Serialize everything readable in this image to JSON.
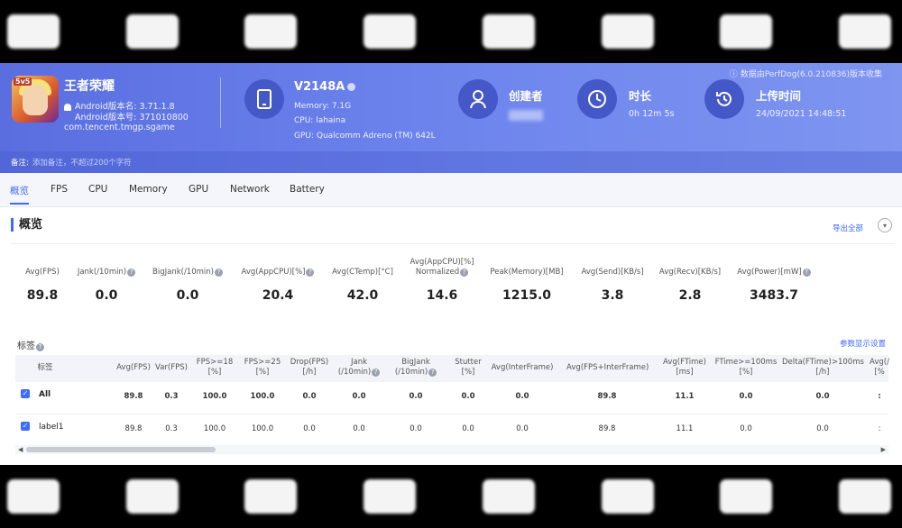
{
  "app": {
    "name": "王者荣耀",
    "icon_tag": "5v5",
    "android_version": "Android版本名: 3.71.1.8",
    "android_code": "Android版本号: 371010800",
    "package": "com.tencent.tmgp.sgame"
  },
  "source_note": "数据由PerfDog(6.0.210836)版本收集",
  "device": {
    "name": "V2148A",
    "memory": "Memory: 7.1G",
    "cpu": "CPU: lahaina",
    "gpu": "GPU: Qualcomm Adreno (TM) 642L"
  },
  "creator": {
    "label": "创建者"
  },
  "duration": {
    "label": "时长",
    "value": "0h 12m 5s"
  },
  "upload": {
    "label": "上传时间",
    "value": "24/09/2021 14:48:51"
  },
  "remark": {
    "label": "备注:",
    "placeholder": "添加备注，不超过200个字符"
  },
  "tabs": [
    "概览",
    "FPS",
    "CPU",
    "Memory",
    "GPU",
    "Network",
    "Battery"
  ],
  "overview": {
    "title": "概览",
    "export": "导出全部",
    "metrics": [
      {
        "label": "Avg(FPS)",
        "value": "89.8",
        "help": false
      },
      {
        "label": "Jank(/10min)",
        "value": "0.0",
        "help": true
      },
      {
        "label": "BigJank(/10min)",
        "value": "0.0",
        "help": true
      },
      {
        "label": "Avg(AppCPU)[%]",
        "value": "20.4",
        "help": true
      },
      {
        "label": "Avg(CTemp)[°C]",
        "value": "42.0",
        "help": false
      },
      {
        "label": "Avg(AppCPU)[%]",
        "label2": "Normalized",
        "value": "14.6",
        "help": true
      },
      {
        "label": "Peak(Memory)[MB]",
        "value": "1215.0",
        "help": false
      },
      {
        "label": "Avg(Send)[KB/s]",
        "value": "3.8",
        "help": false
      },
      {
        "label": "Avg(Recv)[KB/s]",
        "value": "2.8",
        "help": false
      },
      {
        "label": "Avg(Power)[mW]",
        "value": "3483.7",
        "help": true
      }
    ]
  },
  "labels": {
    "title": "标签",
    "param_link": "参数显示设置",
    "columns": [
      {
        "l1": "标签",
        "l2": ""
      },
      {
        "l1": "Avg(FPS)",
        "l2": ""
      },
      {
        "l1": "Var(FPS)",
        "l2": ""
      },
      {
        "l1": "FPS>=18",
        "l2": "[%]"
      },
      {
        "l1": "FPS>=25",
        "l2": "[%]"
      },
      {
        "l1": "Drop(FPS)",
        "l2": "[/h]"
      },
      {
        "l1": "Jank",
        "l2": "(/10min)"
      },
      {
        "l1": "BigJank",
        "l2": "(/10min)"
      },
      {
        "l1": "Stutter",
        "l2": "[%]"
      },
      {
        "l1": "Avg(InterFrame)",
        "l2": ""
      },
      {
        "l1": "Avg(FPS+InterFrame)",
        "l2": ""
      },
      {
        "l1": "Avg(FTime)",
        "l2": "[ms]"
      },
      {
        "l1": "FTime>=100ms",
        "l2": "[%]"
      },
      {
        "l1": "Delta(FTime)>100ms",
        "l2": "[/h]"
      },
      {
        "l1": "Avg(/",
        "l2": "[%"
      }
    ],
    "rows": [
      {
        "name": "All",
        "values": [
          "89.8",
          "0.3",
          "100.0",
          "100.0",
          "0.0",
          "0.0",
          "0.0",
          "0.0",
          "0.0",
          "89.8",
          "11.1",
          "0.0",
          "0.0",
          ":"
        ]
      },
      {
        "name": "label1",
        "values": [
          "89.8",
          "0.3",
          "100.0",
          "100.0",
          "0.0",
          "0.0",
          "0.0",
          "0.0",
          "0.0",
          "89.8",
          "11.1",
          "0.0",
          "0.0",
          ":"
        ]
      }
    ]
  }
}
